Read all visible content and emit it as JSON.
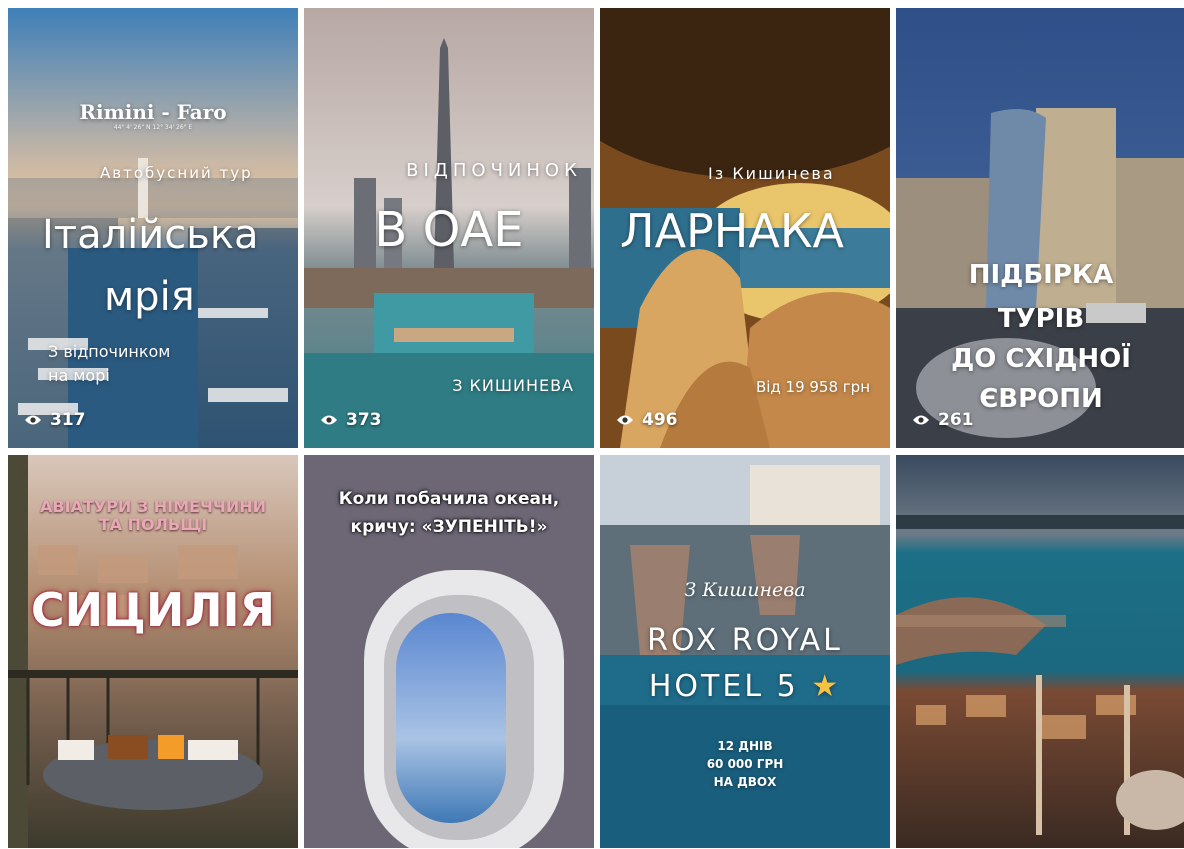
{
  "cards": [
    {
      "overlay_top": "Rimini - Faro",
      "coords": "44° 4' 26\" N   12° 34' 26\" E",
      "kicker": "Автобусний тур",
      "title_line1": "Італійська",
      "title_line2": "мрія",
      "sub_line1": "З відпочинком",
      "sub_line2": "на морі",
      "views": "317"
    },
    {
      "kicker": "ВІДПОЧИНОК",
      "title": "В ОАЕ",
      "sub": "З КИШИНЕВА",
      "views": "373"
    },
    {
      "kicker": "Із Кишинева",
      "title": "ЛАРНАКА",
      "sub": "Від 19 958 грн",
      "views": "496"
    },
    {
      "title_line1": "ПІДБІРКА",
      "title_line2": "ТУРІВ",
      "title_line3": "ДО СХІДНОЇ",
      "title_line4": "ЄВРОПИ",
      "views": "261"
    },
    {
      "kicker_line1": "АВІАТУРИ З НІМЕЧЧИНИ",
      "kicker_line2": "ТА ПОЛЬЩІ",
      "title": "СИЦИЛІЯ"
    },
    {
      "caption_line1": "Коли побачила океан,",
      "caption_line2": "кричу: «ЗУПЕНІТЬ!»"
    },
    {
      "kicker": "З Кишинева",
      "title_line1": "ROX ROYAL",
      "title_line2": "HOTEL 5",
      "star": "★",
      "sub_line1": "12 ДНІВ",
      "sub_line2": "60 000 ГРН",
      "sub_line3": "НА ДВОХ"
    },
    {}
  ],
  "colors": {
    "text": "#ffffff",
    "sicily_title": "#ffffff",
    "aviatury_pink": "#e7a9b6",
    "star": "#f5c242"
  },
  "icons": {
    "views": "eye-icon"
  }
}
